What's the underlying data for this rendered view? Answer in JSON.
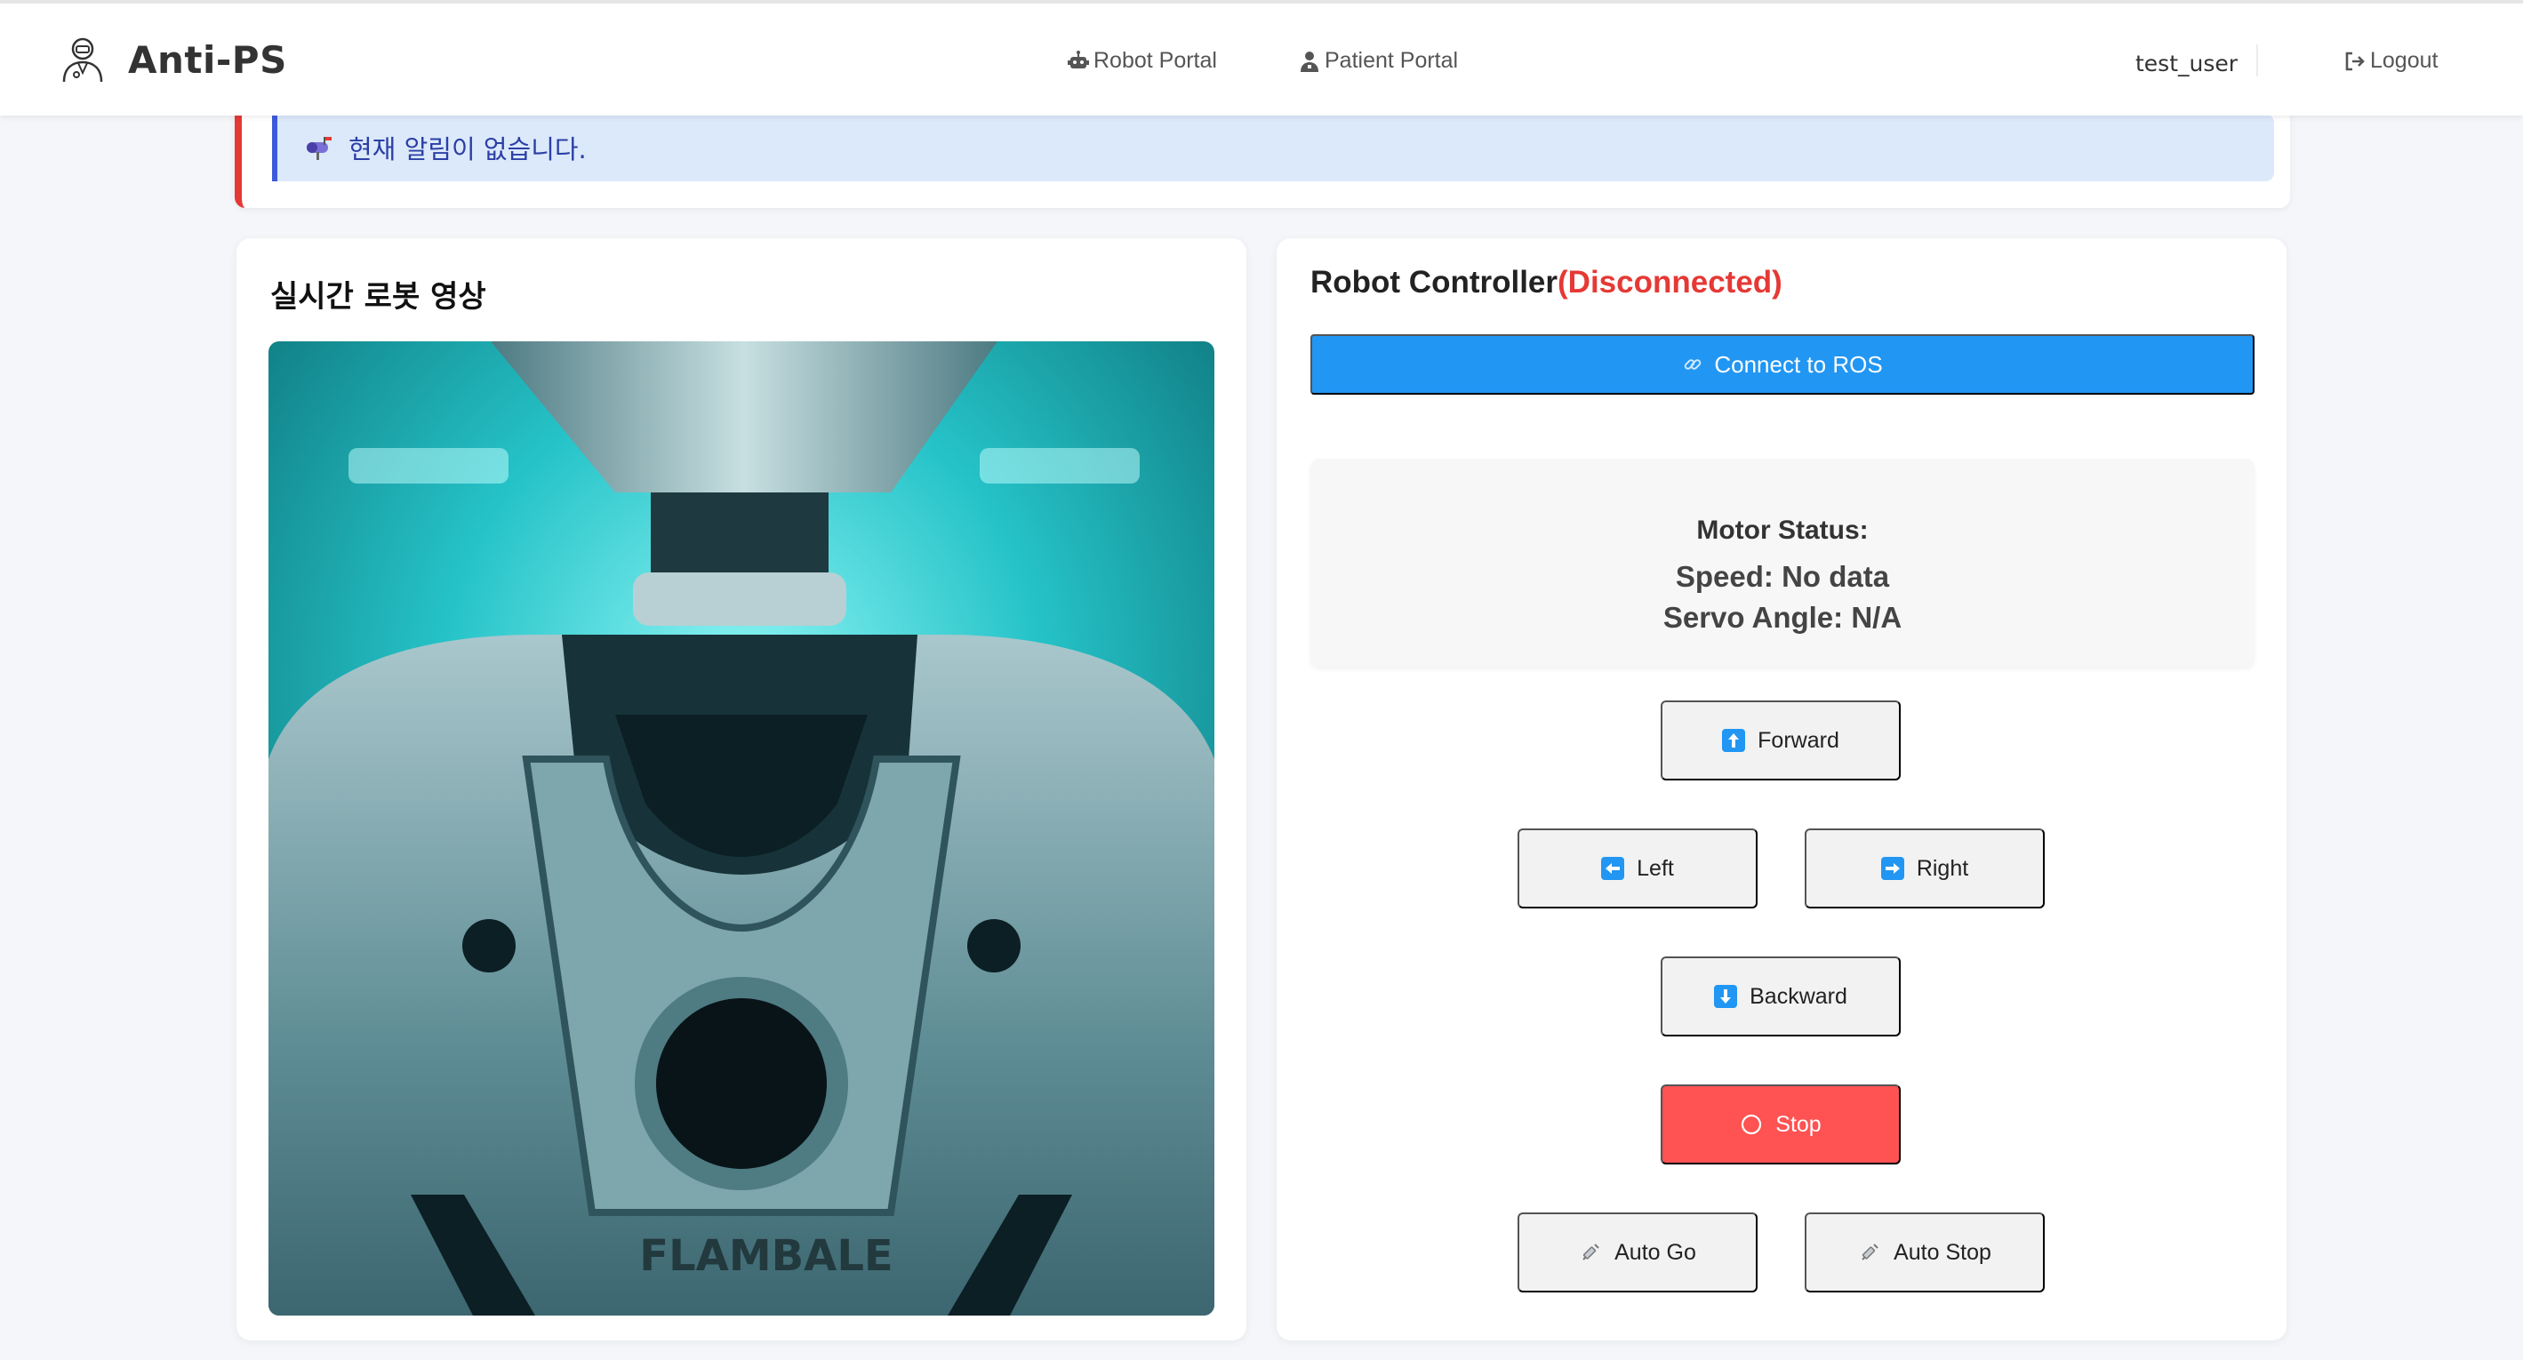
{
  "header": {
    "brand": "Anti-PS",
    "nav": {
      "robot_portal": "Robot Portal",
      "patient_portal": "Patient Portal"
    },
    "user": "test_user",
    "logout": "Logout"
  },
  "alert": {
    "icon": "mailbox-icon",
    "message": "현재 알림이 없습니다."
  },
  "video": {
    "title": "실시간 로봇 영상",
    "frame_label": "FLAMBALE"
  },
  "controller": {
    "title": "Robot Controller",
    "status": "(Disconnected)",
    "connect_label": "Connect to ROS",
    "motor": {
      "heading": "Motor Status:",
      "speed": "Speed: No data",
      "servo": "Servo Angle: N/A"
    },
    "buttons": {
      "forward": "Forward",
      "left": "Left",
      "right": "Right",
      "backward": "Backward",
      "stop": "Stop",
      "auto_go": "Auto Go",
      "auto_stop": "Auto Stop"
    }
  },
  "colors": {
    "primary": "#2196f3",
    "danger": "#ff5252",
    "status_red": "#e53935",
    "alert_bg": "#dbe9fb",
    "alert_text": "#2b3fa6"
  }
}
